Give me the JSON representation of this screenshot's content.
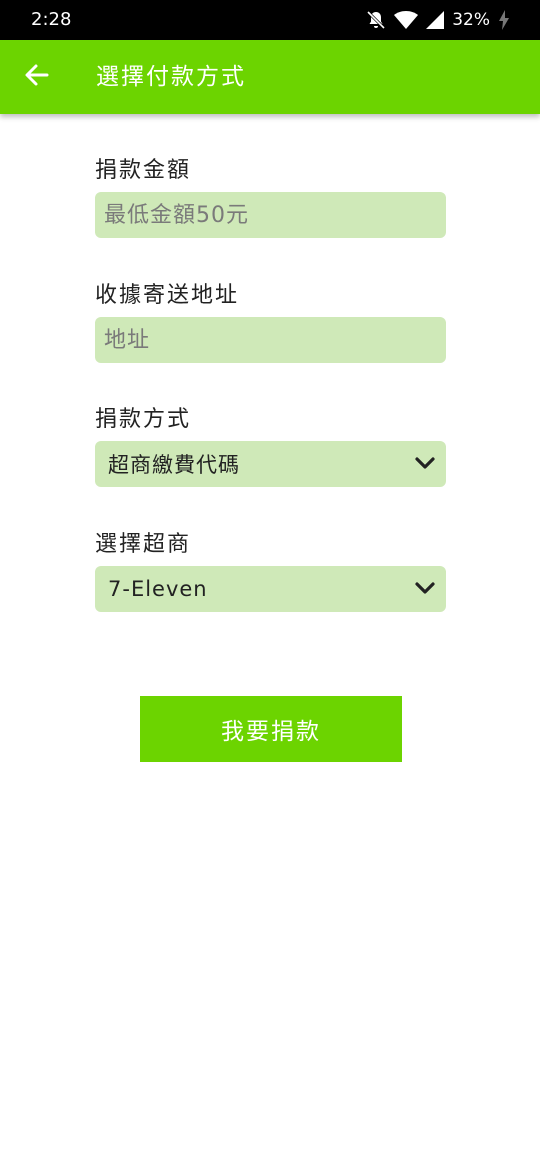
{
  "status_bar": {
    "time": "2:28",
    "battery": "32%",
    "icons": [
      "notifications-off-icon",
      "wifi-icon",
      "signal-icon",
      "battery-charging-icon"
    ]
  },
  "app_bar": {
    "back_icon": "arrow-left-icon",
    "title": "選擇付款方式",
    "color": "#6cd400"
  },
  "form": {
    "amount": {
      "label": "捐款金額",
      "placeholder": "最低金額50元",
      "value": ""
    },
    "address": {
      "label": "收據寄送地址",
      "placeholder": "地址",
      "value": ""
    },
    "method": {
      "label": "捐款方式",
      "selected": "超商繳費代碼",
      "icon": "chevron-down-icon"
    },
    "store": {
      "label": "選擇超商",
      "selected": "7-Eleven",
      "icon": "chevron-down-icon"
    },
    "field_color": "#cfe9b8"
  },
  "submit": {
    "label": "我要捐款"
  }
}
